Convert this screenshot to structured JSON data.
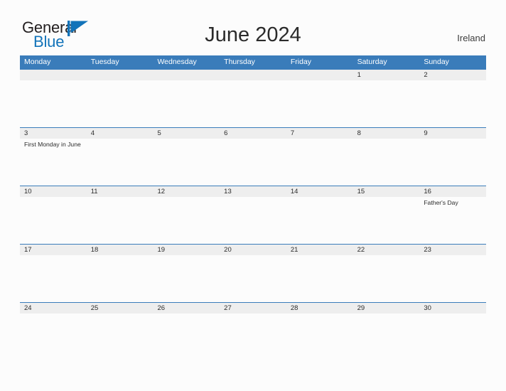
{
  "brand": {
    "word1": "General",
    "word2": "Blue",
    "flag_icon": "blue-pennant-flag-icon",
    "color_dark": "#231f20",
    "color_blue": "#1273b9"
  },
  "header": {
    "title": "June 2024",
    "region": "Ireland"
  },
  "colors": {
    "header_blue": "#3a7cba",
    "date_band": "#eeeeee",
    "page_background": "#fcfcfc",
    "text": "#2b2b2b"
  },
  "calendar": {
    "weekdays": [
      "Monday",
      "Tuesday",
      "Wednesday",
      "Thursday",
      "Friday",
      "Saturday",
      "Sunday"
    ],
    "weeks": [
      {
        "dates": [
          "",
          "",
          "",
          "",
          "",
          "1",
          "2"
        ],
        "events": [
          "",
          "",
          "",
          "",
          "",
          "",
          ""
        ]
      },
      {
        "dates": [
          "3",
          "4",
          "5",
          "6",
          "7",
          "8",
          "9"
        ],
        "events": [
          "First Monday in June",
          "",
          "",
          "",
          "",
          "",
          ""
        ]
      },
      {
        "dates": [
          "10",
          "11",
          "12",
          "13",
          "14",
          "15",
          "16"
        ],
        "events": [
          "",
          "",
          "",
          "",
          "",
          "",
          "Father's Day"
        ]
      },
      {
        "dates": [
          "17",
          "18",
          "19",
          "20",
          "21",
          "22",
          "23"
        ],
        "events": [
          "",
          "",
          "",
          "",
          "",
          "",
          ""
        ]
      },
      {
        "dates": [
          "24",
          "25",
          "26",
          "27",
          "28",
          "29",
          "30"
        ],
        "events": [
          "",
          "",
          "",
          "",
          "",
          "",
          ""
        ]
      }
    ]
  }
}
